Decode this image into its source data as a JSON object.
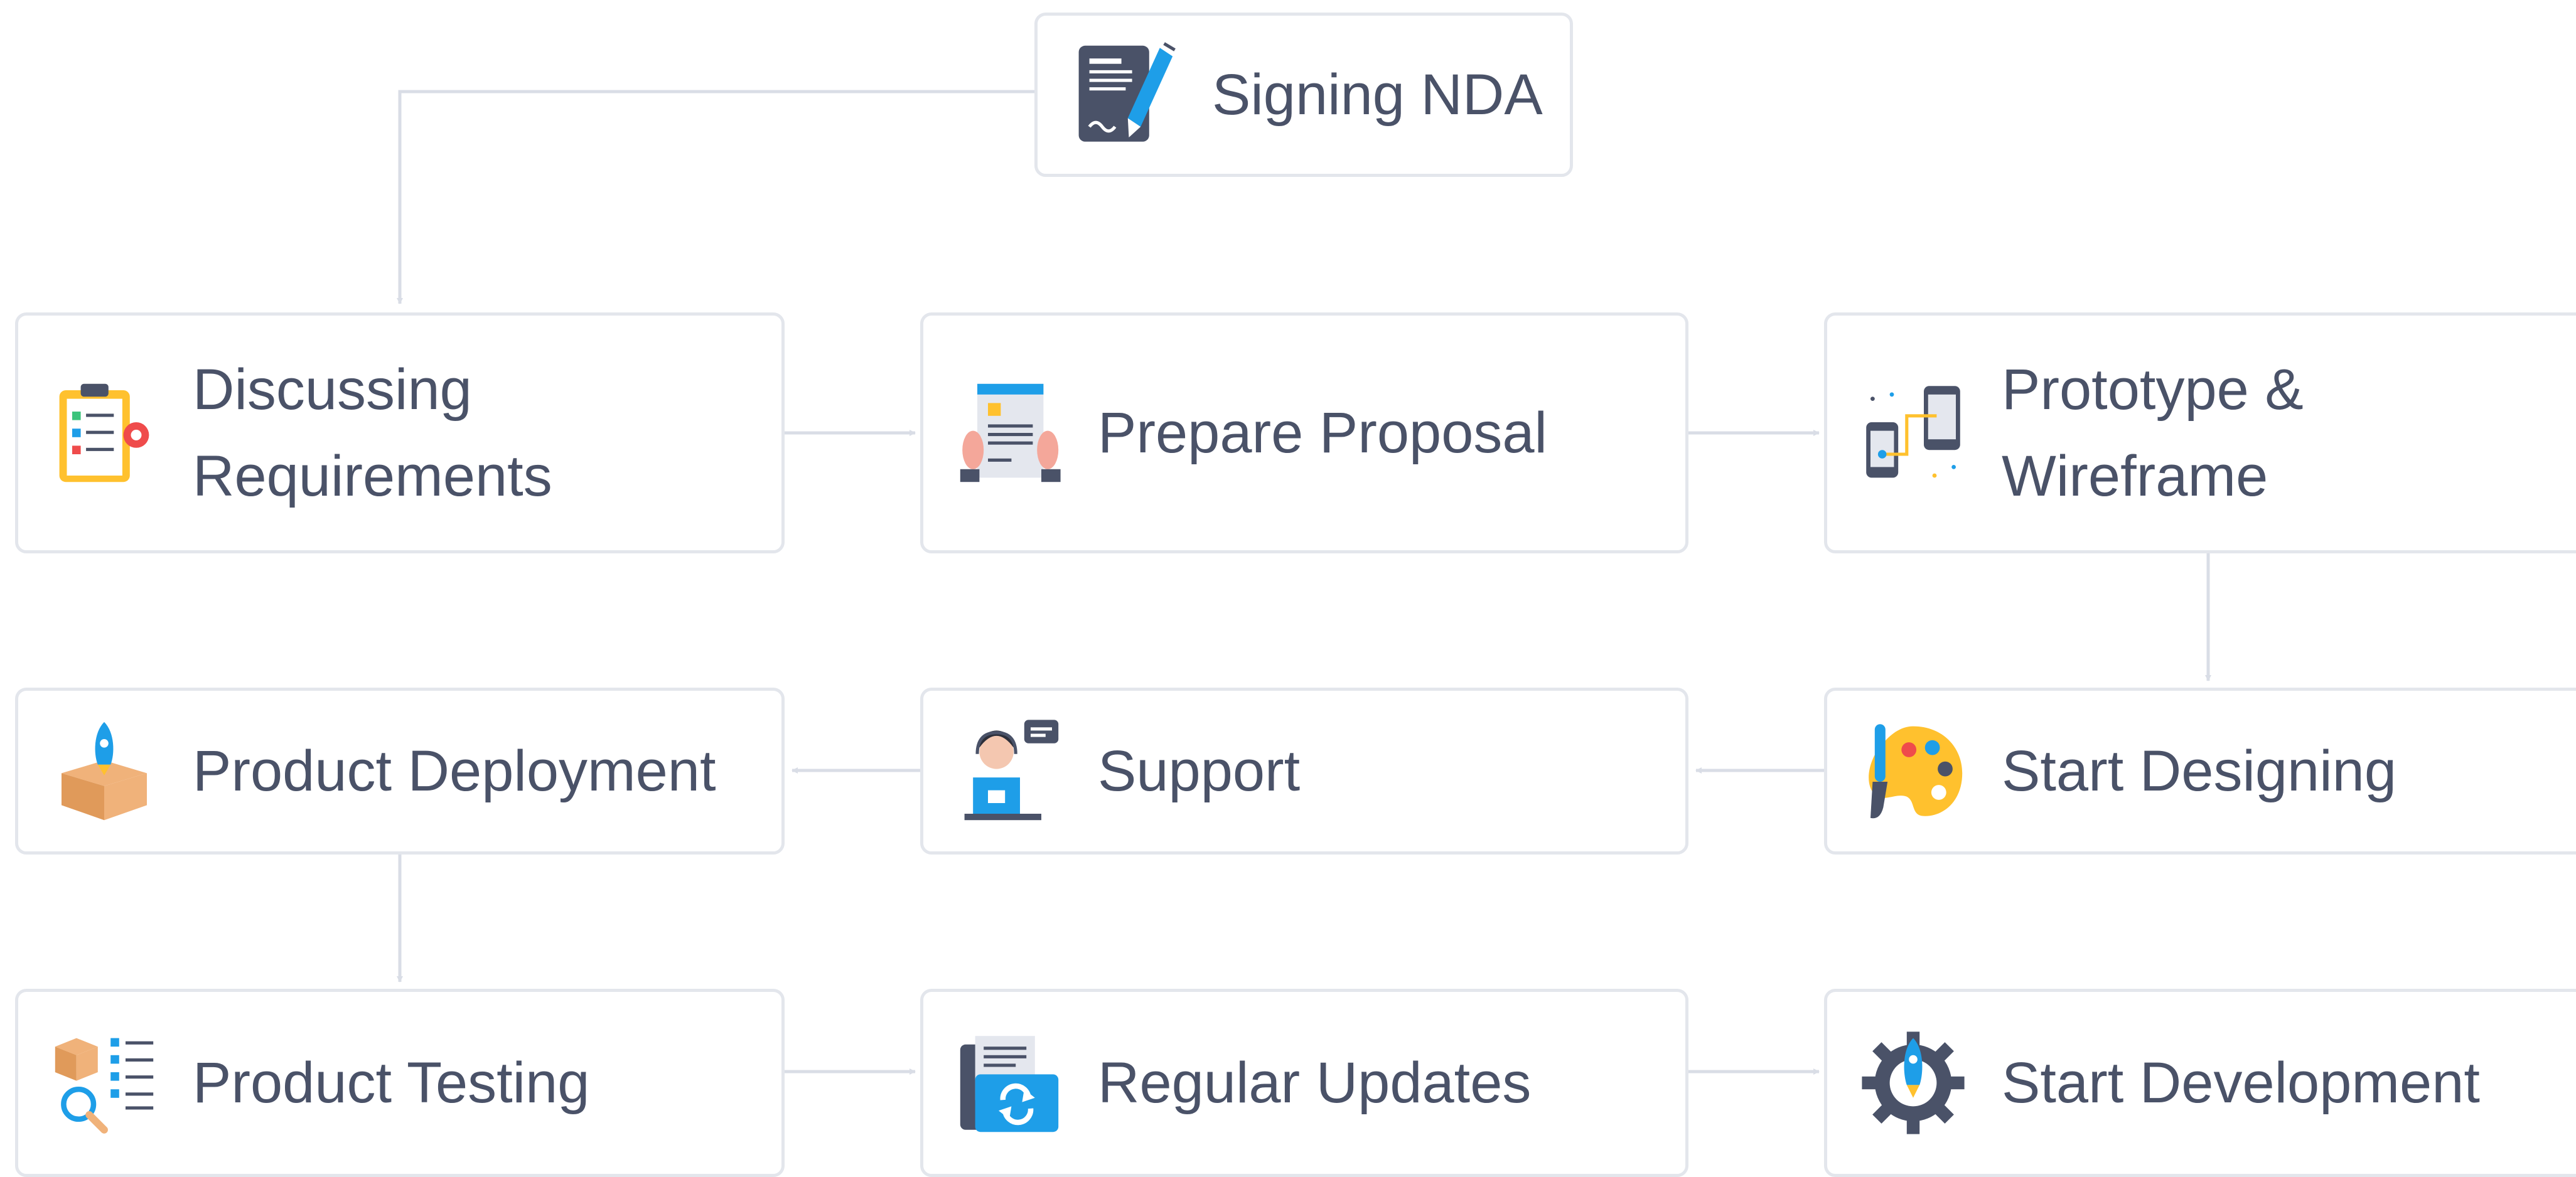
{
  "steps": {
    "signing_nda": "Signing NDA",
    "discussing_requirements": "Discussing Requirements",
    "prepare_proposal": "Prepare Proposal",
    "prototype_wireframe": "Prototype & Wireframe",
    "product_deployment": "Product Deployment",
    "support": "Support",
    "start_designing": "Start Designing",
    "product_testing": "Product Testing",
    "regular_updates": "Regular Updates",
    "start_development": "Start Development"
  },
  "colors": {
    "text": "#4a5268",
    "card_border": "#e3e6ec",
    "connector": "#d9dde6",
    "icon_dark": "#4a5268",
    "icon_blue": "#1e9ee8",
    "icon_yellow": "#ffc12e",
    "icon_red": "#ef4b4b"
  }
}
